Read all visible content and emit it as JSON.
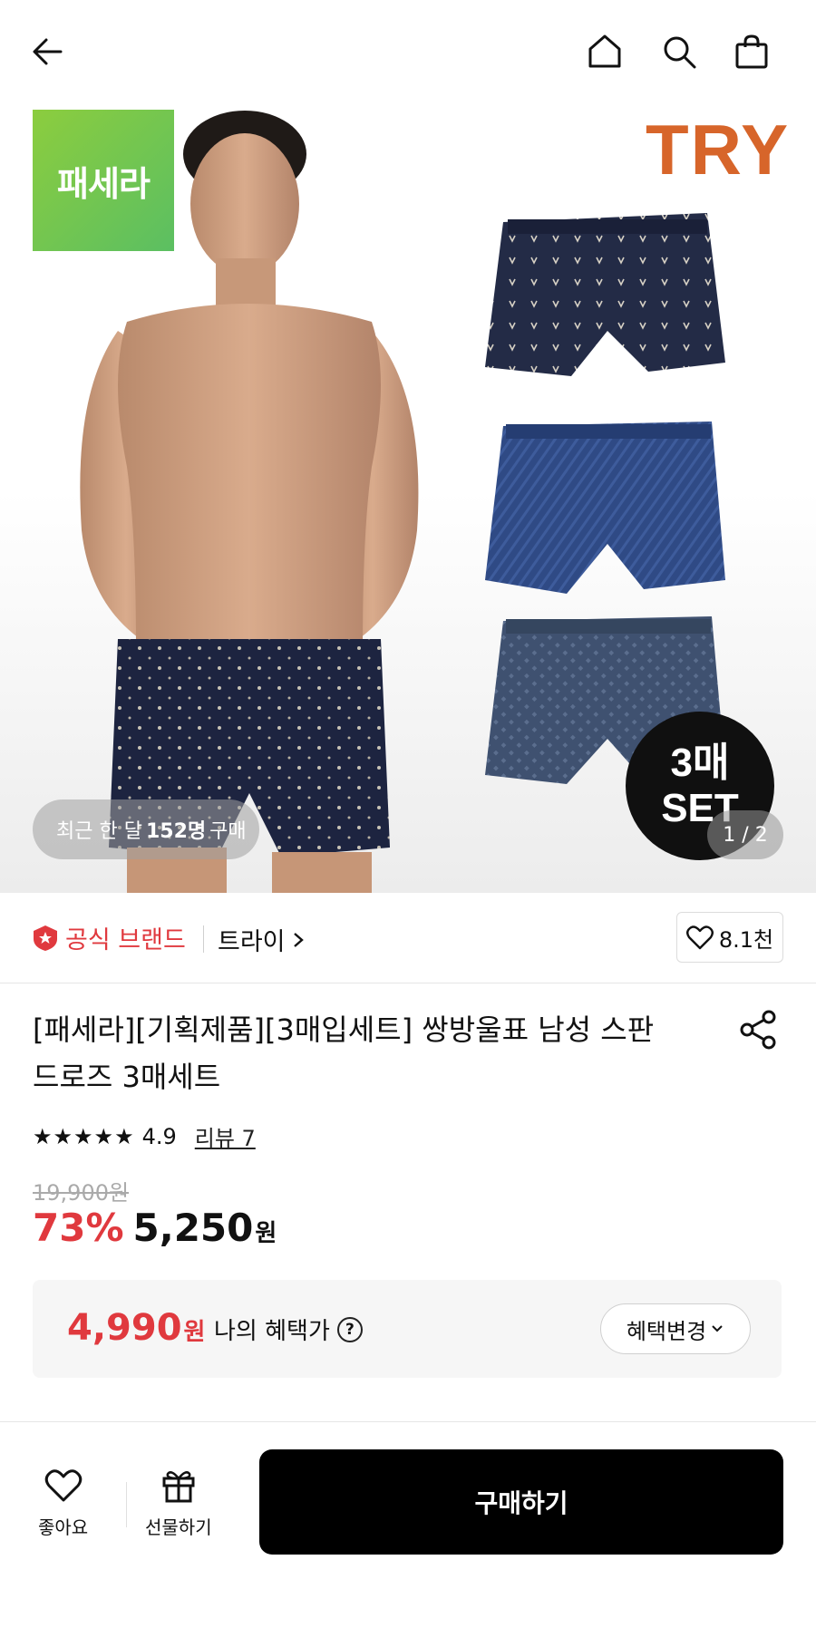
{
  "hero": {
    "brand_logo_text": "패세라",
    "brand_logo_color": "#6ec44f",
    "try_logo_text": "TRY",
    "try_logo_color": "#d7652a",
    "set_badge_line1": "3매",
    "set_badge_line2": "SET",
    "buy_count_prefix": "최근 한 달",
    "buy_count_number": "152명",
    "buy_count_suffix": "구매",
    "page_indicator": "1 / 2"
  },
  "brand_row": {
    "official_label": "공식 브랜드",
    "official_color": "#e0393e",
    "brand_name": "트라이",
    "like_count": "8.1천"
  },
  "product": {
    "title": "[패세라][기획제품][3매입세트] 쌍방울표 남성 스판 드로즈 3매세트",
    "stars": "★★★★★",
    "rating": "4.9",
    "review_link": "리뷰 7",
    "original_price": "19,900원",
    "discount": "73%",
    "price": "5,250",
    "won": "원"
  },
  "benefit": {
    "price": "4,990",
    "won": "원",
    "label": "나의 혜택가",
    "change_button": "혜택변경"
  },
  "bottom_bar": {
    "like_label": "좋아요",
    "gift_label": "선물하기",
    "buy_label": "구매하기"
  }
}
